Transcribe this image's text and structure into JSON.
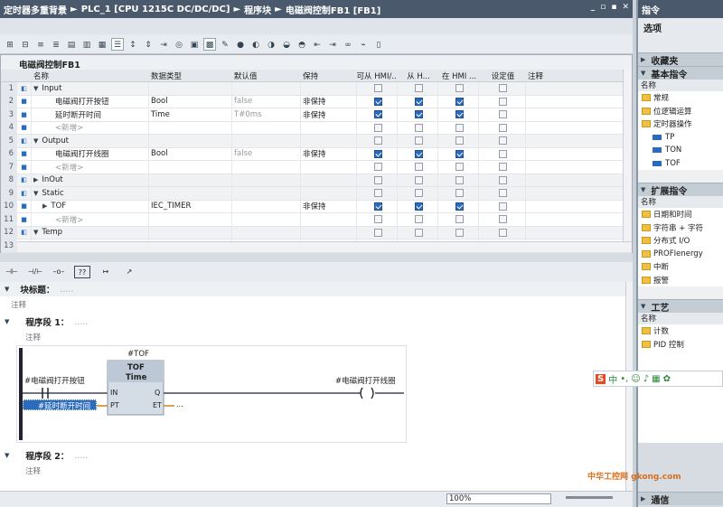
{
  "window": {
    "app_title": "定时器多重背景",
    "breadcrumb": [
      "PLC_1 [CPU 1215C DC/DC/DC]",
      "程序块",
      "电磁阀控制FB1 [FB1]"
    ],
    "controls": [
      "_",
      "▫",
      "▪",
      "✕"
    ]
  },
  "interface": {
    "title": "电磁阀控制FB1",
    "columns": [
      "名称",
      "数据类型",
      "默认值",
      "保持",
      "可从 HMI/...",
      "从 H...",
      "在 HMI ...",
      "设定值",
      "注释"
    ],
    "rows": [
      {
        "num": "1",
        "expand": "▼",
        "name": "Input",
        "type": "",
        "default": "",
        "retain": "",
        "hmi1": null,
        "hmi2": null,
        "hmi3": null,
        "section": true
      },
      {
        "num": "2",
        "expand": "",
        "name": "电磁阀打开按钮",
        "type": "Bool",
        "default": "false",
        "retain": "非保持",
        "hmi1": true,
        "hmi2": true,
        "hmi3": true,
        "section": false
      },
      {
        "num": "3",
        "expand": "",
        "name": "延时断开时间",
        "type": "Time",
        "default": "T#0ms",
        "retain": "非保持",
        "hmi1": true,
        "hmi2": true,
        "hmi3": true,
        "section": false
      },
      {
        "num": "4",
        "expand": "",
        "name": "<新增>",
        "type": "",
        "default": "",
        "retain": "",
        "hmi1": null,
        "hmi2": null,
        "hmi3": null,
        "section": false
      },
      {
        "num": "5",
        "expand": "▼",
        "name": "Output",
        "type": "",
        "default": "",
        "retain": "",
        "hmi1": null,
        "hmi2": null,
        "hmi3": null,
        "section": true
      },
      {
        "num": "6",
        "expand": "",
        "name": "电磁阀打开线圈",
        "type": "Bool",
        "default": "false",
        "retain": "非保持",
        "hmi1": true,
        "hmi2": true,
        "hmi3": true,
        "section": false
      },
      {
        "num": "7",
        "expand": "",
        "name": "<新增>",
        "type": "",
        "default": "",
        "retain": "",
        "hmi1": null,
        "hmi2": null,
        "hmi3": null,
        "section": false
      },
      {
        "num": "8",
        "expand": "▶",
        "name": "InOut",
        "type": "",
        "default": "",
        "retain": "",
        "hmi1": null,
        "hmi2": null,
        "hmi3": null,
        "section": true
      },
      {
        "num": "9",
        "expand": "▼",
        "name": "Static",
        "type": "",
        "default": "",
        "retain": "",
        "hmi1": null,
        "hmi2": null,
        "hmi3": null,
        "section": true
      },
      {
        "num": "10",
        "expand": "▶",
        "name": "TOF",
        "type": "IEC_TIMER",
        "default": "",
        "retain": "非保持",
        "hmi1": true,
        "hmi2": true,
        "hmi3": true,
        "section": false
      },
      {
        "num": "11",
        "expand": "",
        "name": "<新增>",
        "type": "",
        "default": "",
        "retain": "",
        "hmi1": null,
        "hmi2": null,
        "hmi3": null,
        "section": false
      },
      {
        "num": "12",
        "expand": "▼",
        "name": "Temp",
        "type": "",
        "default": "",
        "retain": "",
        "hmi1": null,
        "hmi2": null,
        "hmi3": null,
        "section": true
      },
      {
        "num": "13",
        "expand": "",
        "name": "<新增>",
        "type": "",
        "default": "",
        "retain": "",
        "hmi1": null,
        "hmi2": null,
        "hmi3": null,
        "section": false
      }
    ]
  },
  "ladder_toolbar": [
    "⊣⊢",
    "⊣/⊢",
    "–o–",
    "??",
    "↦",
    "↗"
  ],
  "editor": {
    "block_title_label": "块标题：",
    "block_comment": "注释",
    "network1": {
      "label": "程序段 1：",
      "dots": ".....",
      "comment": "注释"
    },
    "tof_instance": "#TOF",
    "tof_name": "TOF",
    "tof_type": "Time",
    "pin_in": "IN",
    "pin_pt": "PT",
    "pin_q": "Q",
    "pin_et": "ET",
    "et_value": "...",
    "contact_label": "#电磁阀打开按钮",
    "pt_label": "#延时断开时间",
    "coil_label": "#电磁阀打开线圈",
    "network2": {
      "label": "程序段 2：",
      "dots": ".....",
      "comment": "注释"
    }
  },
  "status": {
    "zoom": "100%"
  },
  "right_panel": {
    "title": "指令",
    "options_label": "选项",
    "favorites": "收藏夹",
    "basic": "基本指令",
    "name_col": "名称",
    "basic_items": [
      "常规",
      "位逻辑运算",
      "定时器操作"
    ],
    "timer_items": [
      "TP",
      "TON",
      "TOF"
    ],
    "extended": "扩展指令",
    "extended_items": [
      "日期和时间",
      "字符串 + 字符",
      "分布式 I/O",
      "PROFIenergy",
      "中断",
      "报警"
    ],
    "tech": "工艺",
    "tech_items": [
      "计数",
      "PID 控制"
    ],
    "comm": "通信"
  },
  "watermark": "中华工控网 gkong.com"
}
